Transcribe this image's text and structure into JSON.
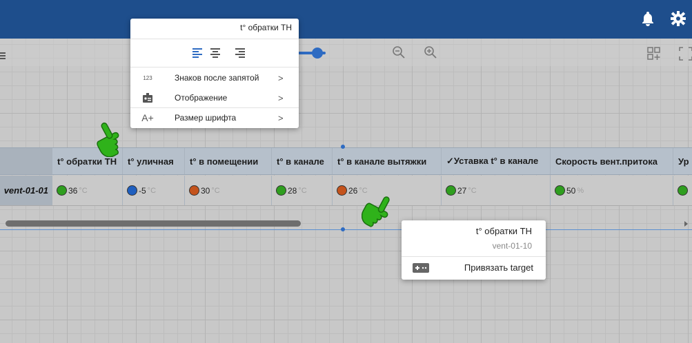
{
  "colors": {
    "appbar": "#1e4e8c",
    "accent": "#2e6bc2",
    "dot_green": "#2f9e1f",
    "dot_blue": "#1f5fbf",
    "dot_orange": "#c4531c",
    "pointer": "#2fb21a"
  },
  "appbar": {
    "icons": [
      "bell-icon",
      "gear-icon"
    ]
  },
  "table": {
    "headers": [
      "t° обратки ТН",
      "t° уличная",
      "t° в помещении",
      "t° в канале",
      "t° в канале вытяжки",
      "✓Уставка t° в канале",
      "Скорость вент.притока",
      "Ур"
    ],
    "row_label": "vent-01-01",
    "cells": [
      {
        "value": "36",
        "unit": "°C",
        "color": "#2f9e1f"
      },
      {
        "value": "-5",
        "unit": "°C",
        "color": "#1f5fbf"
      },
      {
        "value": "30",
        "unit": "°C",
        "color": "#c4531c"
      },
      {
        "value": "28",
        "unit": "°C",
        "color": "#2f9e1f"
      },
      {
        "value": "26",
        "unit": "°C",
        "color": "#c4531c"
      },
      {
        "value": "27",
        "unit": "°C",
        "color": "#2f9e1f"
      },
      {
        "value": "50",
        "unit": "%",
        "color": "#2f9e1f"
      },
      {
        "value": "",
        "unit": "",
        "color": "#2f9e1f"
      }
    ]
  },
  "context_menu": {
    "title": "t° обратки ТН",
    "items": [
      {
        "icon_text": "123",
        "label": "Знаков после запятой",
        "chevron": ">"
      },
      {
        "icon_text": "",
        "label": "Отображение",
        "chevron": ">"
      },
      {
        "icon_text": "A+",
        "label": "Размер шрифта",
        "chevron": ">"
      }
    ]
  },
  "tooltip_menu": {
    "title": "t° обратки ТН",
    "subtitle": "vent-01-10",
    "item_label": "Привязать target"
  }
}
